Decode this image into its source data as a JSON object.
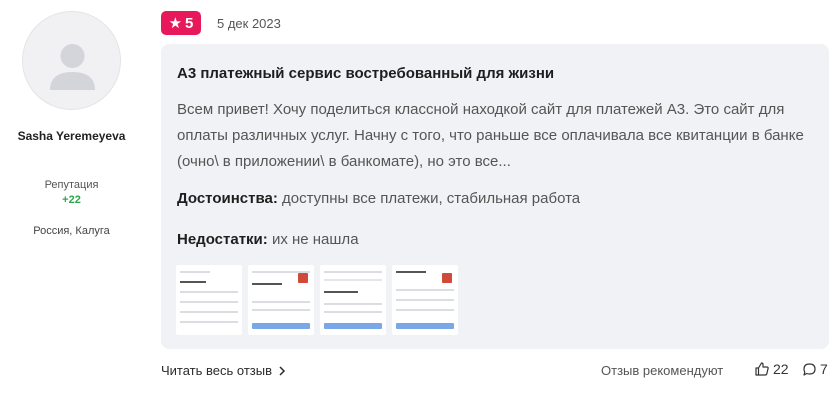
{
  "author": {
    "name": "Sasha Yeremeyeva",
    "reputation_label": "Репутация",
    "reputation_value": "+22",
    "location": "Россия, Калуга"
  },
  "review": {
    "rating": "5",
    "date": "5 дек 2023",
    "title": "А3 платежный сервис востребованный для жизни",
    "text": "Всем привет! Хочу поделиться классной находкой сайт для платежей А3. Это сайт для оплаты различных услуг. Начну с того, что раньше все оплачивала все квитанции в банке (очно\\ в приложении\\ в банкомате), но это все...",
    "pros_label": "Достоинства:",
    "pros": "доступны все платежи, стабильная работа",
    "cons_label": "Недостатки:",
    "cons": "их не нашла",
    "images_count": 4
  },
  "footer": {
    "read_more": "Читать весь отзыв",
    "recommend_label": "Отзыв рекомендуют",
    "likes": "22",
    "comments": "7"
  },
  "colors": {
    "badge": "#e8195a",
    "reputation": "#2aa84a",
    "card_bg": "#f1f2f5"
  },
  "icons": {
    "rating": "star-icon",
    "read_more": "chevron-right-icon",
    "likes": "thumbs-up-icon",
    "comments": "comment-icon"
  }
}
